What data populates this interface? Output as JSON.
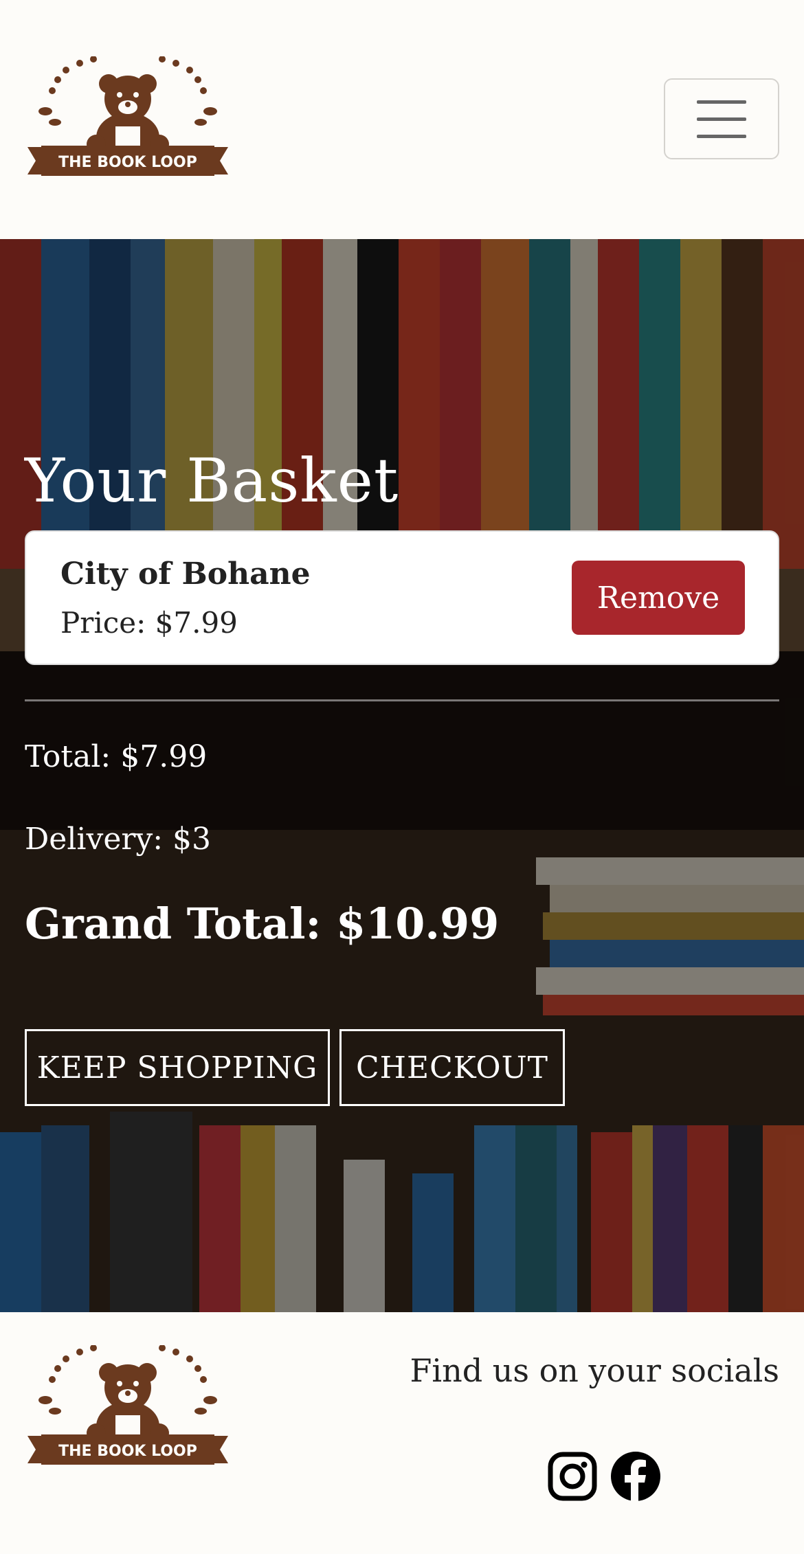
{
  "brand": {
    "name": "THE BOOK LOOP",
    "color": "#6b3a1f"
  },
  "header": {
    "menu_icon": "hamburger-menu-icon"
  },
  "basket": {
    "title": "Your Basket",
    "items": [
      {
        "title": "City of Bohane",
        "price": "Price: $7.99",
        "remove_label": "Remove"
      }
    ],
    "total": "Total: $7.99",
    "delivery": "Delivery: $3",
    "grand_total": "Grand Total: $10.99",
    "keep_shopping_label": "KEEP SHOPPING",
    "checkout_label": "CHECKOUT"
  },
  "footer": {
    "socials_title": "Find us on your socials",
    "icons": [
      "instagram-icon",
      "facebook-icon"
    ]
  },
  "colors": {
    "remove": "#a8262c",
    "background": "#fdfcf9"
  }
}
